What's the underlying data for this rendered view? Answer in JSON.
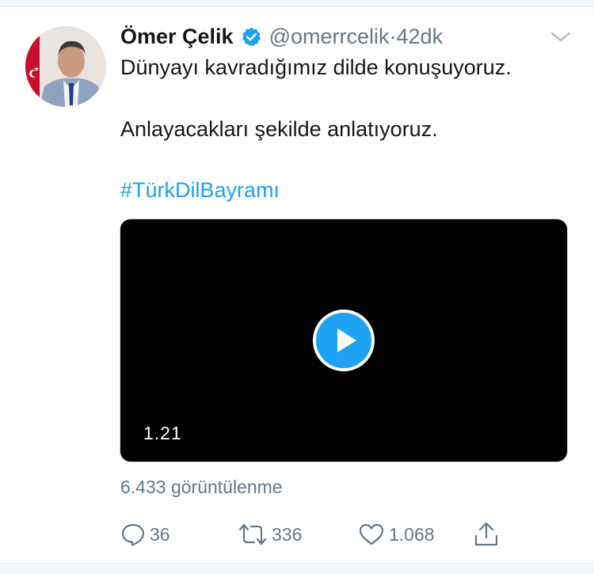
{
  "tweet": {
    "author_name": "Ömer Çelik",
    "handle": "@omerrcelik",
    "separator": " · ",
    "time": "42dk",
    "line1": "Dünyayı kavradığımız dilde konuşuyoruz.",
    "line2": "Anlayacakları şekilde anlatıyoruz.",
    "hashtag": "#TürkDilBayramı"
  },
  "video": {
    "duration": "1.21"
  },
  "stats": {
    "views": "6.433 görüntülenme",
    "replies": "36",
    "retweets": "336",
    "likes": "1.068"
  },
  "icons": {
    "verified": "verified-badge-icon",
    "menu": "chevron-down-icon",
    "play": "play-icon",
    "reply": "reply-icon",
    "retweet": "retweet-icon",
    "like": "heart-icon",
    "share": "share-icon"
  },
  "colors": {
    "accent": "#1da1f2",
    "muted": "#657786",
    "text": "#14171a"
  }
}
